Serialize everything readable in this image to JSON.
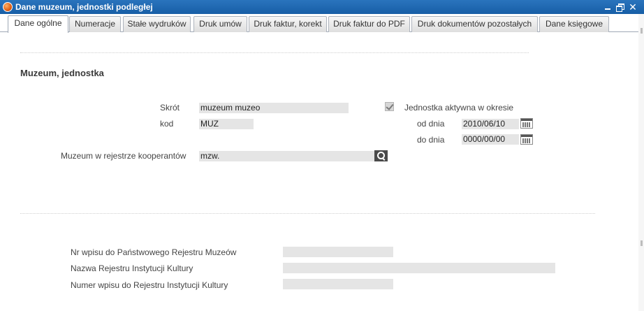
{
  "window": {
    "title": "Dane muzeum, jednostki podległej",
    "close_glyph": "✕"
  },
  "tabs": [
    {
      "label": "Dane ogólne",
      "active": true
    },
    {
      "label": "Numeracje"
    },
    {
      "label": "Stałe wydruków"
    },
    {
      "label": "Druk umów"
    },
    {
      "label": "Druk faktur, korekt"
    },
    {
      "label": "Druk faktur do PDF"
    },
    {
      "label": "Druk dokumentów pozostałych"
    },
    {
      "label": "Dane księgowe"
    }
  ],
  "section": {
    "title": "Muzeum, jednostka"
  },
  "form": {
    "skrot": {
      "label": "Skrót",
      "value": "muzeum muzeo"
    },
    "kod": {
      "label": "kod",
      "value": "MUZ"
    },
    "active": {
      "label": "Jednostka aktywna w okresie",
      "checked": true
    },
    "od_dnia": {
      "label": "od dnia",
      "value": "2010/06/10"
    },
    "do_dnia": {
      "label": "do dnia",
      "value": "0000/00/00"
    },
    "museum_registry": {
      "label": "Muzeum w rejestrze kooperantów",
      "value": "mzw."
    }
  },
  "registry": {
    "nr_wpisu": {
      "label": "Nr wpisu do Państwowego Rejestru Muzeów",
      "value": ""
    },
    "nazwa_rejestru": {
      "label": "Nazwa Rejestru Instytucji Kultury",
      "value": ""
    },
    "numer_wpisu": {
      "label": "Numer wpisu do Rejestru Instytucji Kultury",
      "value": ""
    }
  },
  "icons": {
    "app": "museum-app-icon",
    "minimize": "minimize-icon",
    "maximize": "maximize-icon",
    "close": "close-icon",
    "calendar": "calendar-icon",
    "search": "search-icon"
  },
  "colors": {
    "titlebar": "#1f68b0",
    "field_bg": "#e5e5e5",
    "tab_border": "#9fa8b5"
  }
}
